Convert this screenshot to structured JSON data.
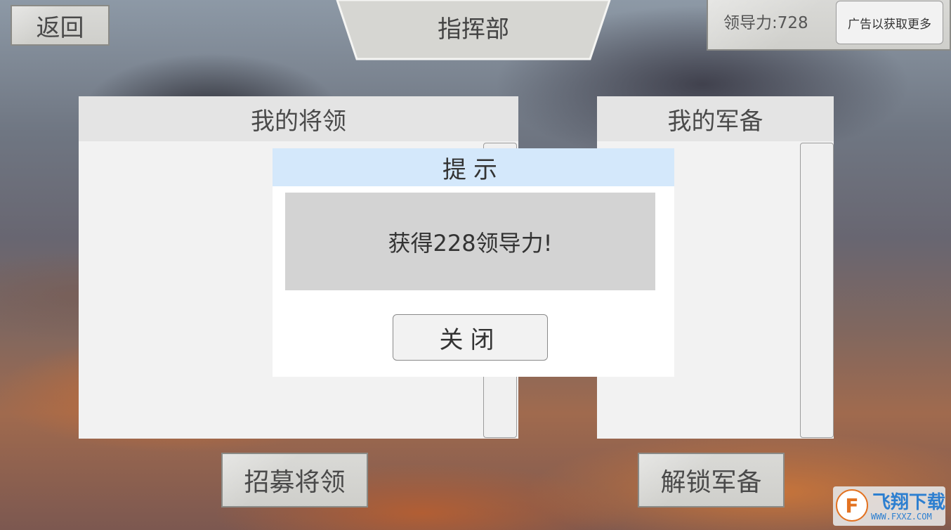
{
  "header": {
    "back_label": "返回",
    "title": "指挥部",
    "leadership_text": "领导力:728",
    "ad_button_label": "广告以获取更多"
  },
  "panels": {
    "generals_title": "我的将领",
    "equipment_title": "我的军备"
  },
  "bottom_buttons": {
    "recruit_label": "招募将领",
    "unlock_label": "解锁军备"
  },
  "dialog": {
    "title": "提示",
    "message": "获得228领导力!",
    "close_label": "关闭"
  },
  "watermark": {
    "brand": "飞翔下载",
    "url": "WWW.FXXZ.COM"
  },
  "colors": {
    "dialog_title_bg": "#d4e8fb",
    "message_bg": "#d3d3d3",
    "panel_header_bg": "#e4e4e4",
    "watermark_accent": "#e37221"
  }
}
